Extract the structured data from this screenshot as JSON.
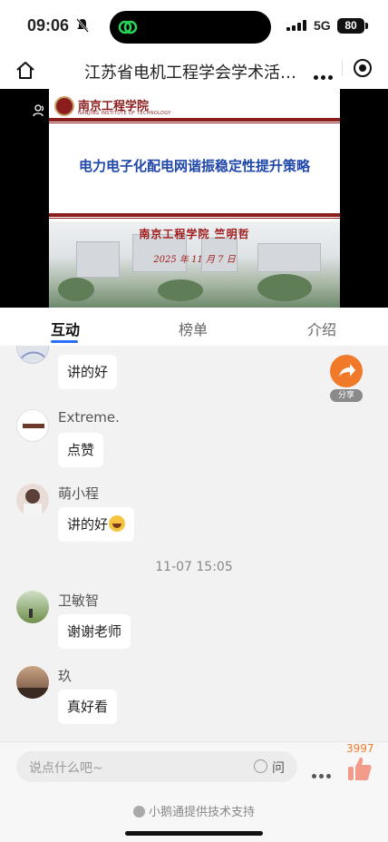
{
  "status_bar": {
    "time": "09:06",
    "network": "5G",
    "battery": "80"
  },
  "nav": {
    "title": "江苏省电机工程学会学术活…"
  },
  "slide": {
    "school_name": "南京工程学院",
    "school_name_en": "NANJING INSTITUTE OF TECHNOLOGY",
    "topic": "电力电子化配电网谐振稳定性提升策略",
    "author": "南京工程学院 竺明哲",
    "date": "2025 年 11 月 7 日"
  },
  "tabs": [
    {
      "label": "互动",
      "active": true
    },
    {
      "label": "榜单",
      "active": false
    },
    {
      "label": "介绍",
      "active": false
    }
  ],
  "messages": [
    {
      "name": "",
      "text": "讲的好"
    },
    {
      "name": "Extreme.",
      "text": "点赞"
    },
    {
      "name": "萌小程",
      "text": "讲的好",
      "emoji": "grinning-face"
    },
    {
      "name": "卫敏智",
      "text": "谢谢老师"
    },
    {
      "name": "玖",
      "text": "真好看"
    }
  ],
  "timestamp": "11-07 15:05",
  "share_label": "分享",
  "input": {
    "placeholder": "说点什么吧~",
    "ask_label": "问"
  },
  "likes_count": "3997",
  "footer_credit": "小鹅通提供技术支持",
  "colors": {
    "accent": "#2a6ff5",
    "share": "#f07a2a",
    "slide_red": "#8b1d1d",
    "slide_blue": "#1f47a8"
  }
}
